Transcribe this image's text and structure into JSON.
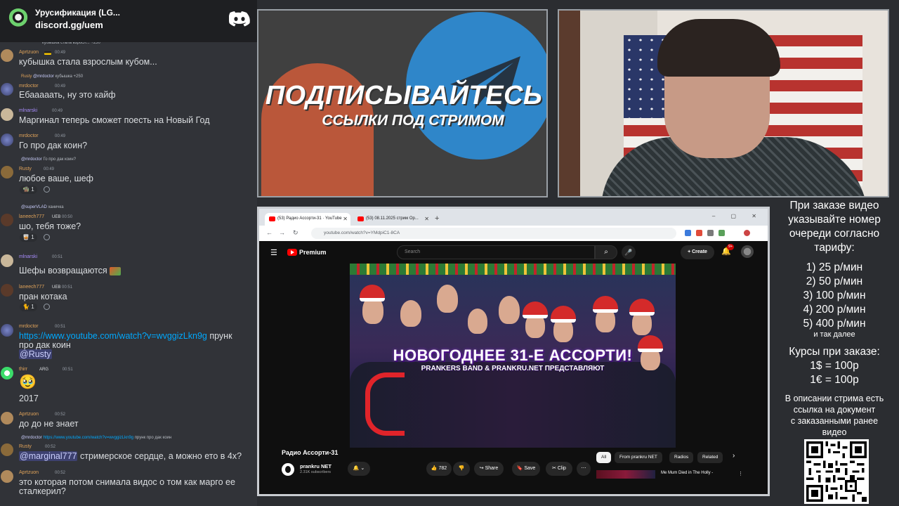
{
  "discord": {
    "server_name": "Урусификация (LG...",
    "invite": "discord.gg/uem",
    "messages": [
      {
        "reply": "кубышка стала взросл... +250",
        "user": "Aprtzuon",
        "time": "00:49",
        "text": "кубышка стала взрослым кубом..."
      },
      {
        "reply_user": "Rusty",
        "reply_mention": "@mrdoctor",
        "reply": "кубышка +250",
        "user": "mrdoctor",
        "time": "00:49",
        "text": "Ебааааать, ну это кайф"
      },
      {
        "user": "mlnarski",
        "time": "00:49",
        "text": "Маргинал теперь сможет поесть на Новый Год"
      },
      {
        "user": "mrdoctor",
        "time": "00:49",
        "text": "Го про дак коин?"
      },
      {
        "reply_mention": "@mrdoctor",
        "reply": "Го про дак коин?",
        "user": "Rusty",
        "time": "00:49",
        "text": "любое ваше, шеф",
        "reaction_count": "1"
      },
      {
        "reply_mention": "@superVLAD",
        "reply": "ханичка",
        "user": "laneech777",
        "tag": "UEB",
        "time": "00:50",
        "text": "шо, тебя тоже?",
        "reaction_count": "1"
      },
      {
        "user": "mlnarski",
        "time": "00:51",
        "text": "Шефы возвращаются"
      },
      {
        "user": "laneech777",
        "tag": "UEB",
        "time": "00:51",
        "text": "пран котака",
        "reaction_count": "1"
      },
      {
        "user": "mrdoctor",
        "time": "00:51",
        "link": "https://www.youtube.com/watch?v=wvggizLkn9g",
        "text_after": "прунк",
        "line2": "про дак коин",
        "mention": "@Rusty"
      },
      {
        "user": "thirr",
        "tag": "ARG",
        "time": "00:51",
        "emoji": "🥹",
        "text": "2017"
      },
      {
        "user": "Aprtzuon",
        "time": "00:52",
        "text": "до до не знает"
      },
      {
        "reply_mention": "@mrdoctor",
        "reply_link": "https://www.youtube.com/watch?v=wvggizLkn9g",
        "reply": "прунк про дак коин",
        "user": "Rusty",
        "time": "00:52",
        "mention": "@marginal777",
        "text": "стримерское сердце, а можно ето в 4х?"
      },
      {
        "user": "Aprtzuon",
        "time": "00:52",
        "text": "это которая потом снимала видос о том как марго ее",
        "line2": "сталкерил?"
      }
    ]
  },
  "promo": {
    "title": "ПОДПИСЫВАЙТЕСЬ",
    "subtitle": "ССЫЛКИ ПОД СТРИМОМ"
  },
  "browser": {
    "tabs": [
      {
        "label": "(53) Радио Ассорти-31 · YouTube"
      },
      {
        "label": "(53) 08.11.2025 стрим Ор..."
      }
    ],
    "url": "youtube.com/watch?v=YMdpiC1-8CA",
    "youtube": {
      "brand": "Premium",
      "search_placeholder": "Search",
      "create_label": "Create",
      "notif_count": "9+",
      "video_overlay_title": "НОВОГОДНЕЕ 31-Е АССОРТИ!",
      "video_overlay_sub": "PRANKERS BAND & PRANKRU.NET ПРЕДСТАВЛЯЮТ",
      "video_title": "Радио Ассорти-31",
      "channel_name": "prankru NET",
      "channel_subs": "2.31K subscribers",
      "likes": "782",
      "share_label": "Share",
      "save_label": "Save",
      "clip_label": "Clip",
      "chips": [
        "All",
        "From prankru NET",
        "Radios",
        "Related"
      ],
      "rec_title": "Me Mum Died in The Holly -"
    }
  },
  "info": {
    "heading_lines": [
      "При заказе видео",
      "указывайте номер",
      "очереди согласно",
      "тарифу:"
    ],
    "tariffs": [
      "1) 25 р/мин",
      "2) 50 р/мин",
      "3) 100 р/мин",
      "4) 200 р/мин",
      "5) 400 р/мин"
    ],
    "etc": "и так далее",
    "rates_title": "Курсы при заказе:",
    "rates": [
      "1$ = 100р",
      "1€ = 100р"
    ],
    "note_lines": [
      "В описании стрима есть",
      "ссылка на документ",
      "с заказанными ранее",
      "видео"
    ]
  },
  "colors": {
    "discord_bg": "#313338",
    "username_orange": "#e0a35a",
    "username_purple": "#a78bfa",
    "link": "#00a8fc",
    "youtube_red": "#ff0000"
  }
}
